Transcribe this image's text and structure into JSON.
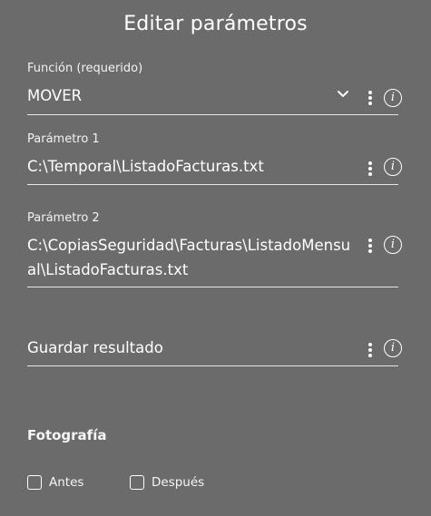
{
  "dialog": {
    "title": "Editar parámetros"
  },
  "fields": [
    {
      "label": "Función (requerido)",
      "value": "MOVER",
      "type": "select"
    },
    {
      "label": "Parámetro 1",
      "value": "C:\\Temporal\\ListadoFacturas.txt"
    },
    {
      "label": "Parámetro 2",
      "value": "C:\\CopiasSeguridad\\Facturas\\ListadoMensual\\ListadoFacturas.txt"
    },
    {
      "label": "",
      "value": "Guardar resultado"
    }
  ],
  "photo_section": {
    "title": "Fotografía",
    "options": [
      {
        "label": "Antes",
        "checked": false
      },
      {
        "label": "Después",
        "checked": false
      }
    ]
  },
  "icons": {
    "info": "i",
    "menu": "vertical-dots",
    "dropdown": "chevron-down"
  }
}
